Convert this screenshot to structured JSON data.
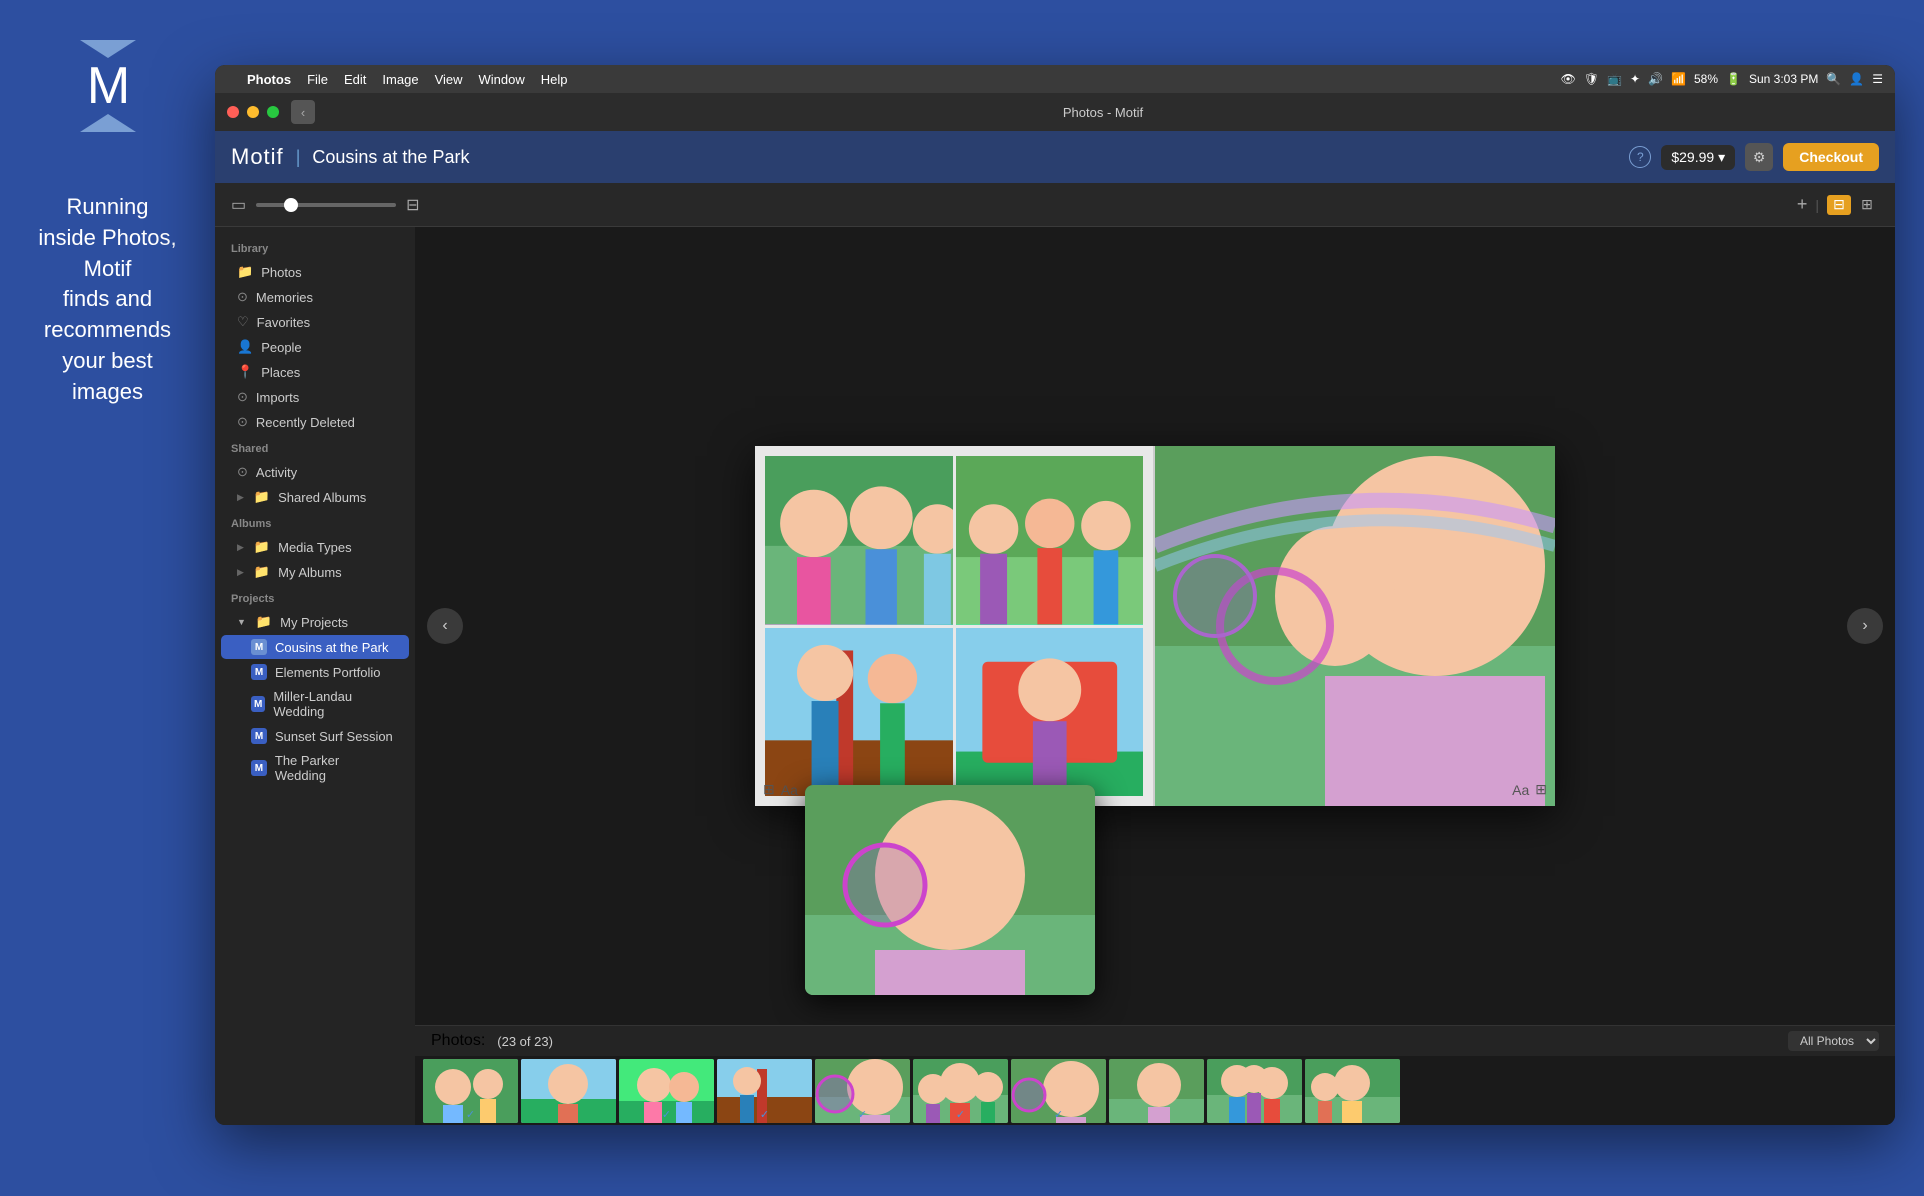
{
  "branding": {
    "logo_letter": "M",
    "tagline_line1": "Running",
    "tagline_line2": "inside Photos,",
    "tagline_line3": "Motif",
    "tagline_line4": "finds and",
    "tagline_line5": "recommends",
    "tagline_line6": "your best",
    "tagline_line7": "images"
  },
  "menu_bar": {
    "apple": "",
    "items": [
      "Photos",
      "File",
      "Edit",
      "Image",
      "View",
      "Window",
      "Help"
    ],
    "active_item": "Photos",
    "right": {
      "time": "Sun 3:03 PM",
      "battery": "58%",
      "wifi_icon": "wifi",
      "bluetooth_icon": "bluetooth",
      "volume_icon": "volume"
    }
  },
  "title_bar": {
    "title": "Photos - Motif"
  },
  "toolbar": {
    "motif_label": "Motif",
    "divider": "|",
    "project_name": "Cousins at the Park",
    "help_label": "?",
    "price": "$29.99",
    "price_dropdown": "▾",
    "gear_label": "⚙",
    "checkout_label": "Checkout"
  },
  "layout_bar": {
    "add_label": "+",
    "view_grid_label": "⊞",
    "view_list_label": "☰"
  },
  "sidebar": {
    "library_header": "Library",
    "library_items": [
      {
        "label": "Photos",
        "icon": "📁",
        "id": "photos"
      },
      {
        "label": "Memories",
        "icon": "⊙",
        "id": "memories"
      },
      {
        "label": "Favorites",
        "icon": "♡",
        "id": "favorites"
      },
      {
        "label": "People",
        "icon": "👤",
        "id": "people"
      },
      {
        "label": "Places",
        "icon": "📍",
        "id": "places"
      },
      {
        "label": "Imports",
        "icon": "⊙",
        "id": "imports"
      },
      {
        "label": "Recently Deleted",
        "icon": "⊙",
        "id": "recently-deleted"
      }
    ],
    "shared_header": "Shared",
    "shared_items": [
      {
        "label": "Activity",
        "icon": "⊙",
        "id": "activity"
      },
      {
        "label": "Shared Albums",
        "icon": "📁",
        "id": "shared-albums",
        "has_arrow": true
      }
    ],
    "albums_header": "Albums",
    "albums_items": [
      {
        "label": "Media Types",
        "icon": "📁",
        "id": "media-types",
        "has_arrow": true
      },
      {
        "label": "My Albums",
        "icon": "📁",
        "id": "my-albums",
        "has_arrow": true
      }
    ],
    "projects_header": "Projects",
    "projects_items": [
      {
        "label": "My Projects",
        "icon": "📁",
        "id": "my-projects",
        "expanded": true
      }
    ],
    "project_children": [
      {
        "label": "Cousins at the Park",
        "id": "cousins-park",
        "active": true
      },
      {
        "label": "Elements Portfolio",
        "id": "elements-portfolio"
      },
      {
        "label": "Miller-Landau Wedding",
        "id": "miller-landau"
      },
      {
        "label": "Sunset Surf Session",
        "id": "sunset-surf"
      },
      {
        "label": "The Parker Wedding",
        "id": "parker-wedding"
      }
    ]
  },
  "book_editor": {
    "nav_left": "‹",
    "nav_right": "›",
    "page_tool_left": "⊞",
    "page_tool_text": "Aa",
    "page_tool_right_text": "Aa",
    "page_tool_right_icon": "⊞"
  },
  "photos_strip": {
    "label": "Photos:",
    "count": "(23 of 23)",
    "dropdown_label": "All Photos",
    "thumbnails_count": 10
  }
}
